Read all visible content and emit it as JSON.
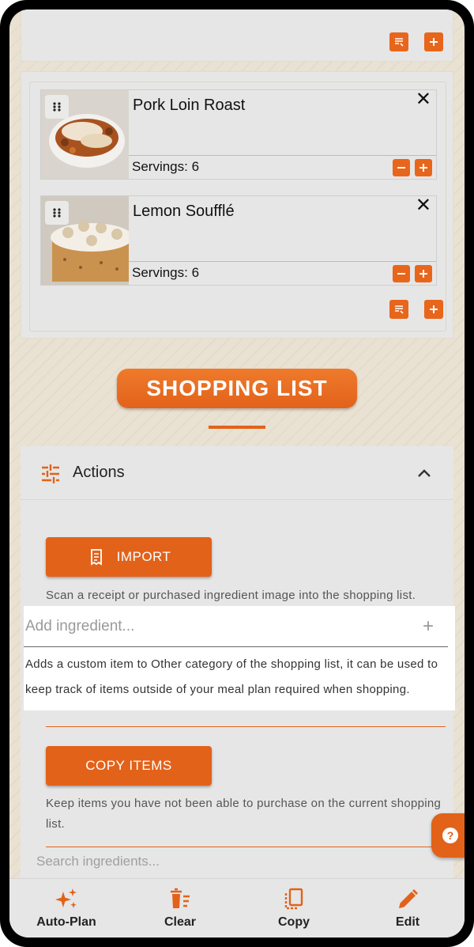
{
  "meal_plan": {
    "recipes": [
      {
        "title": "Pork Loin Roast",
        "servings": "Servings: 6",
        "close": "✕"
      },
      {
        "title": "Lemon Soufflé",
        "servings": "Servings: 6",
        "close": "✕"
      }
    ]
  },
  "shopping_list": {
    "heading": "SHOPPING LIST",
    "actions": {
      "title": "Actions",
      "import_label": "IMPORT",
      "import_desc": "Scan a receipt or purchased ingredient image into the shopping list.",
      "add_placeholder": "Add ingredient...",
      "add_plus": "+",
      "add_desc": "Adds a custom item to Other category of the shopping list, it can be used to keep track of items outside of your meal plan required when shopping.",
      "copy_label": "COPY ITEMS",
      "copy_desc": "Keep items you have not been able to purchase on the current shopping list.",
      "search_placeholder": "Search ingredients..."
    },
    "help": "?"
  },
  "bottom_nav": {
    "items": [
      {
        "label": "Auto-Plan",
        "icon": "sparkles-icon"
      },
      {
        "label": "Clear",
        "icon": "trash-list-icon"
      },
      {
        "label": "Copy",
        "icon": "copy-icon"
      },
      {
        "label": "Edit",
        "icon": "pencil-icon"
      }
    ]
  },
  "colors": {
    "accent": "#e2621a",
    "panel": "#e6e6e6",
    "background": "#e9e1d2"
  }
}
